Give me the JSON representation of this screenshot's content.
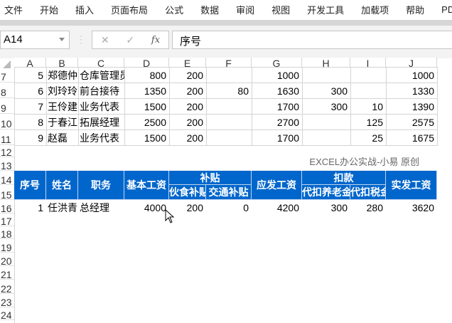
{
  "menu": [
    "文件",
    "开始",
    "插入",
    "页面布局",
    "公式",
    "数据",
    "审阅",
    "视图",
    "开发工具",
    "加载项",
    "帮助",
    "PDF"
  ],
  "formula_bar": {
    "name_box": "A14",
    "cancel": "✕",
    "enter": "✓",
    "fx": "fx",
    "content": "序号"
  },
  "columns": [
    "A",
    "B",
    "C",
    "D",
    "E",
    "F",
    "G",
    "H",
    "I",
    "J"
  ],
  "rows": [
    {
      "n": "7",
      "cells": [
        "5",
        "郑德仲",
        "仓库管理员",
        "800",
        "200",
        "",
        "1000",
        "",
        "",
        "1000"
      ]
    },
    {
      "n": "8",
      "cells": [
        "6",
        "刘玲玲",
        "前台接待",
        "1350",
        "200",
        "80",
        "1630",
        "300",
        "",
        "1330"
      ]
    },
    {
      "n": "9",
      "cells": [
        "7",
        "王伶建",
        "业务代表",
        "1500",
        "200",
        "",
        "1700",
        "300",
        "10",
        "1390"
      ]
    },
    {
      "n": "10",
      "cells": [
        "8",
        "于春江",
        "拓展经理",
        "2500",
        "200",
        "",
        "2700",
        "",
        "125",
        "2575"
      ]
    },
    {
      "n": "11",
      "cells": [
        "9",
        "赵磊",
        "业务代表",
        "1500",
        "200",
        "",
        "1700",
        "",
        "25",
        "1675"
      ]
    }
  ],
  "row_numbers_lower": [
    "12",
    "13",
    "14",
    "15",
    "16",
    "17",
    "18",
    "19",
    "20",
    "21",
    "22",
    "23",
    "24"
  ],
  "watermark": "EXCEL办公实战-小易 原创",
  "header": {
    "seq": "序号",
    "name": "姓名",
    "role": "职务",
    "base": "基本工资",
    "allowance": "补贴",
    "meal": "伙食补贴",
    "transport": "交通补贴",
    "gross": "应发工资",
    "deduct": "扣款",
    "pension": "代扣养老金",
    "tax": "代扣税金",
    "net": "实发工资"
  },
  "data_row": {
    "n": "16",
    "cells": [
      "1",
      "任洪青",
      "总经理",
      "4000",
      "200",
      "0",
      "4200",
      "300",
      "280",
      "3620"
    ]
  },
  "colors": {
    "header_blue": "#0066cc"
  }
}
